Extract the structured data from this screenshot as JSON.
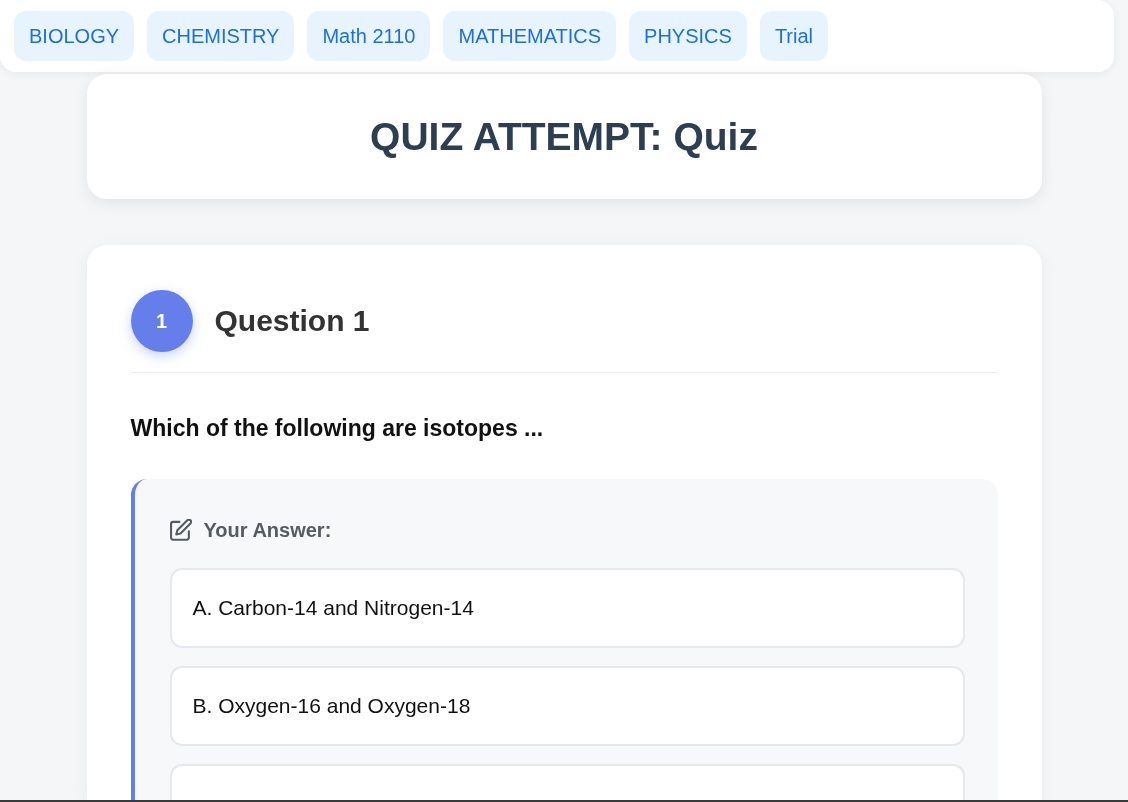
{
  "subject_links": [
    {
      "label": "BIOLOGY"
    },
    {
      "label": "CHEMISTRY"
    },
    {
      "label": "Math 2110"
    },
    {
      "label": "MATHEMATICS"
    },
    {
      "label": "PHYSICS"
    },
    {
      "label": "Trial"
    }
  ],
  "page_title": "QUIZ ATTEMPT: Quiz",
  "questions": [
    {
      "number": "1",
      "heading": "Question 1",
      "text": "Which of the following are isotopes ...",
      "answer": {
        "label": "Your Answer:",
        "options": [
          {
            "text": "A. Carbon-14 and Nitrogen-14",
            "selected": false
          },
          {
            "text": "B. Oxygen-16 and Oxygen-18",
            "selected": false
          },
          {
            "selected": false
          }
        ]
      }
    }
  ]
}
